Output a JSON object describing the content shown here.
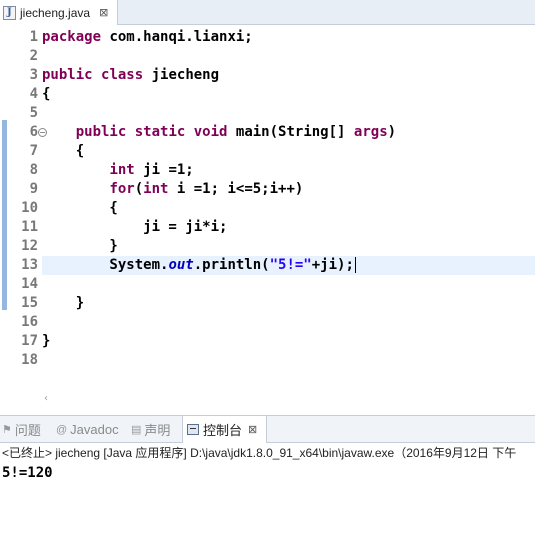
{
  "editor_tab": {
    "file_name": "jiecheng.java",
    "close": "⊠"
  },
  "editor": {
    "line_numbers": [
      "1",
      "2",
      "3",
      "4",
      "5",
      "6",
      "7",
      "8",
      "9",
      "10",
      "11",
      "12",
      "13",
      "14",
      "15",
      "16",
      "17",
      "18"
    ],
    "fold_marker": "⊖",
    "lines": [
      [
        {
          "t": "package",
          "c": "kw"
        },
        {
          "t": " com.hanqi.lianxi;"
        }
      ],
      [],
      [
        {
          "t": "public",
          "c": "kw"
        },
        {
          "t": " "
        },
        {
          "t": "class",
          "c": "kw"
        },
        {
          "t": " jiecheng"
        }
      ],
      [
        {
          "t": "{"
        }
      ],
      [],
      [
        {
          "t": "    "
        },
        {
          "t": "public",
          "c": "kw"
        },
        {
          "t": " "
        },
        {
          "t": "static",
          "c": "kw"
        },
        {
          "t": " "
        },
        {
          "t": "void",
          "c": "kw"
        },
        {
          "t": " main(String[] "
        },
        {
          "t": "args",
          "c": "kw"
        },
        {
          "t": ")"
        }
      ],
      [
        {
          "t": "    {"
        }
      ],
      [
        {
          "t": "        "
        },
        {
          "t": "int",
          "c": "kw"
        },
        {
          "t": " ji =1;"
        }
      ],
      [
        {
          "t": "        "
        },
        {
          "t": "for",
          "c": "kw"
        },
        {
          "t": "("
        },
        {
          "t": "int",
          "c": "kw"
        },
        {
          "t": " i =1; i<=5;i++)"
        }
      ],
      [
        {
          "t": "        {"
        }
      ],
      [
        {
          "t": "            ji = ji*i;"
        }
      ],
      [
        {
          "t": "        }"
        }
      ],
      [
        {
          "t": "        System."
        },
        {
          "t": "out",
          "c": "fld"
        },
        {
          "t": ".println("
        },
        {
          "t": "\"5!=\"",
          "c": "str"
        },
        {
          "t": "+ji);"
        }
      ],
      [],
      [
        {
          "t": "    }"
        }
      ],
      [],
      [
        {
          "t": "}"
        }
      ],
      []
    ],
    "current_line": 13
  },
  "panel": {
    "tabs": [
      {
        "label": "问题",
        "icon": "problems-icon"
      },
      {
        "label": "Javadoc",
        "icon": "javadoc-icon"
      },
      {
        "label": "声明",
        "icon": "declaration-icon"
      },
      {
        "label": "控制台",
        "icon": "console-icon",
        "close": "⊠"
      }
    ],
    "console_header": "<已终止> jiecheng [Java 应用程序] D:\\java\\jdk1.8.0_91_x64\\bin\\javaw.exe（2016年9月12日 下午",
    "console_output": "5!=120"
  }
}
